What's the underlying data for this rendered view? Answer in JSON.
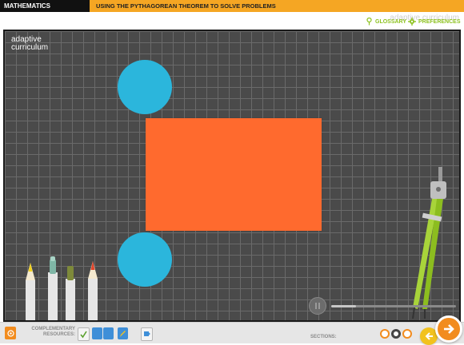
{
  "header": {
    "subject": "MATHEMATICS",
    "lesson_title": "USING THE PYTHAGOREAN THEOREM TO SOLVE PROBLEMS",
    "brand_watermark": "adaptive curriculum"
  },
  "toolbar": {
    "glossary_label": "GLOSSARY",
    "preferences_label": "PREFERENCES"
  },
  "canvas": {
    "logo_line1": "adaptive",
    "logo_line2": "curriculum"
  },
  "player": {
    "state": "paused",
    "progress": 0.2
  },
  "footer": {
    "complementary_label_1": "COMPLEMENTARY",
    "complementary_label_2": "RESOURCES:",
    "sections_label": "SECTIONS:",
    "resource_icons": [
      "checklist-icon",
      "document-icon",
      "document-icon",
      "edit-icon",
      "puzzle-icon"
    ],
    "section_count": 3,
    "current_section": 2
  },
  "colors": {
    "accent_orange": "#f5a623",
    "shape_circle": "#2bb6dc",
    "shape_rect": "#ff6a2e",
    "link_green": "#8dc21f"
  }
}
